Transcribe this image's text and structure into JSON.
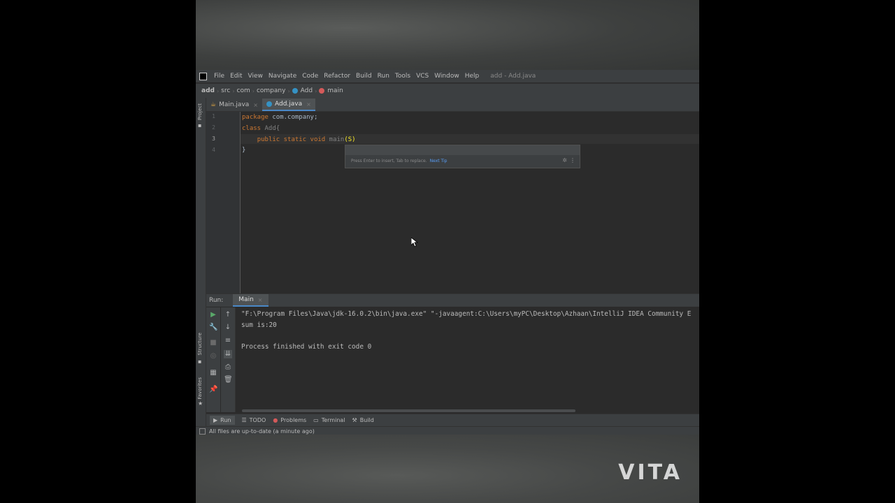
{
  "menubar": {
    "items": [
      "File",
      "Edit",
      "View",
      "Navigate",
      "Code",
      "Refactor",
      "Build",
      "Run",
      "Tools",
      "VCS",
      "Window",
      "Help"
    ],
    "window_title": "add - Add.java"
  },
  "breadcrumbs": {
    "project": "add",
    "items": [
      "src",
      "com",
      "company",
      "Add",
      "main"
    ]
  },
  "side_strip": {
    "project_label": "Project",
    "structure_label": "Structure",
    "favorites_label": "Favorites"
  },
  "tabs": [
    {
      "label": "Main.java",
      "active": false
    },
    {
      "label": "Add.java",
      "active": true
    }
  ],
  "editor": {
    "line_numbers": [
      "1",
      "2",
      "3",
      "4"
    ],
    "lines": {
      "l1_kw": "package",
      "l1_rest": " com.company;",
      "l2_kw": "class",
      "l2_rest": " Add{",
      "l3_indent": "    ",
      "l3_kw": "public static void",
      "l3_rest": " main",
      "l3_paren": "(S)",
      "l4": "}"
    },
    "hint": {
      "text": "Press Enter to insert, Tab to replace.",
      "link": "Next Tip"
    }
  },
  "run_panel": {
    "label": "Run:",
    "tab": "Main",
    "console_lines": [
      "\"F:\\Program Files\\Java\\jdk-16.0.2\\bin\\java.exe\" \"-javaagent:C:\\Users\\myPC\\Desktop\\Azhaan\\IntelliJ IDEA Community E",
      "sum is:20",
      "",
      "Process finished with exit code 0"
    ]
  },
  "tool_windows": [
    {
      "label": "Run",
      "icon": "play-icon",
      "active": true
    },
    {
      "label": "TODO",
      "icon": "list-icon",
      "active": false
    },
    {
      "label": "Problems",
      "icon": "error-icon",
      "active": false
    },
    {
      "label": "Terminal",
      "icon": "terminal-icon",
      "active": false
    },
    {
      "label": "Build",
      "icon": "hammer-icon",
      "active": false
    }
  ],
  "status": {
    "text": "All files are up-to-date (a minute ago)"
  },
  "watermark": "VITA",
  "colors": {
    "keyword": "#cc7832",
    "identifier": "#a9b7c6",
    "accent": "#4a88c7",
    "link": "#589df6"
  }
}
